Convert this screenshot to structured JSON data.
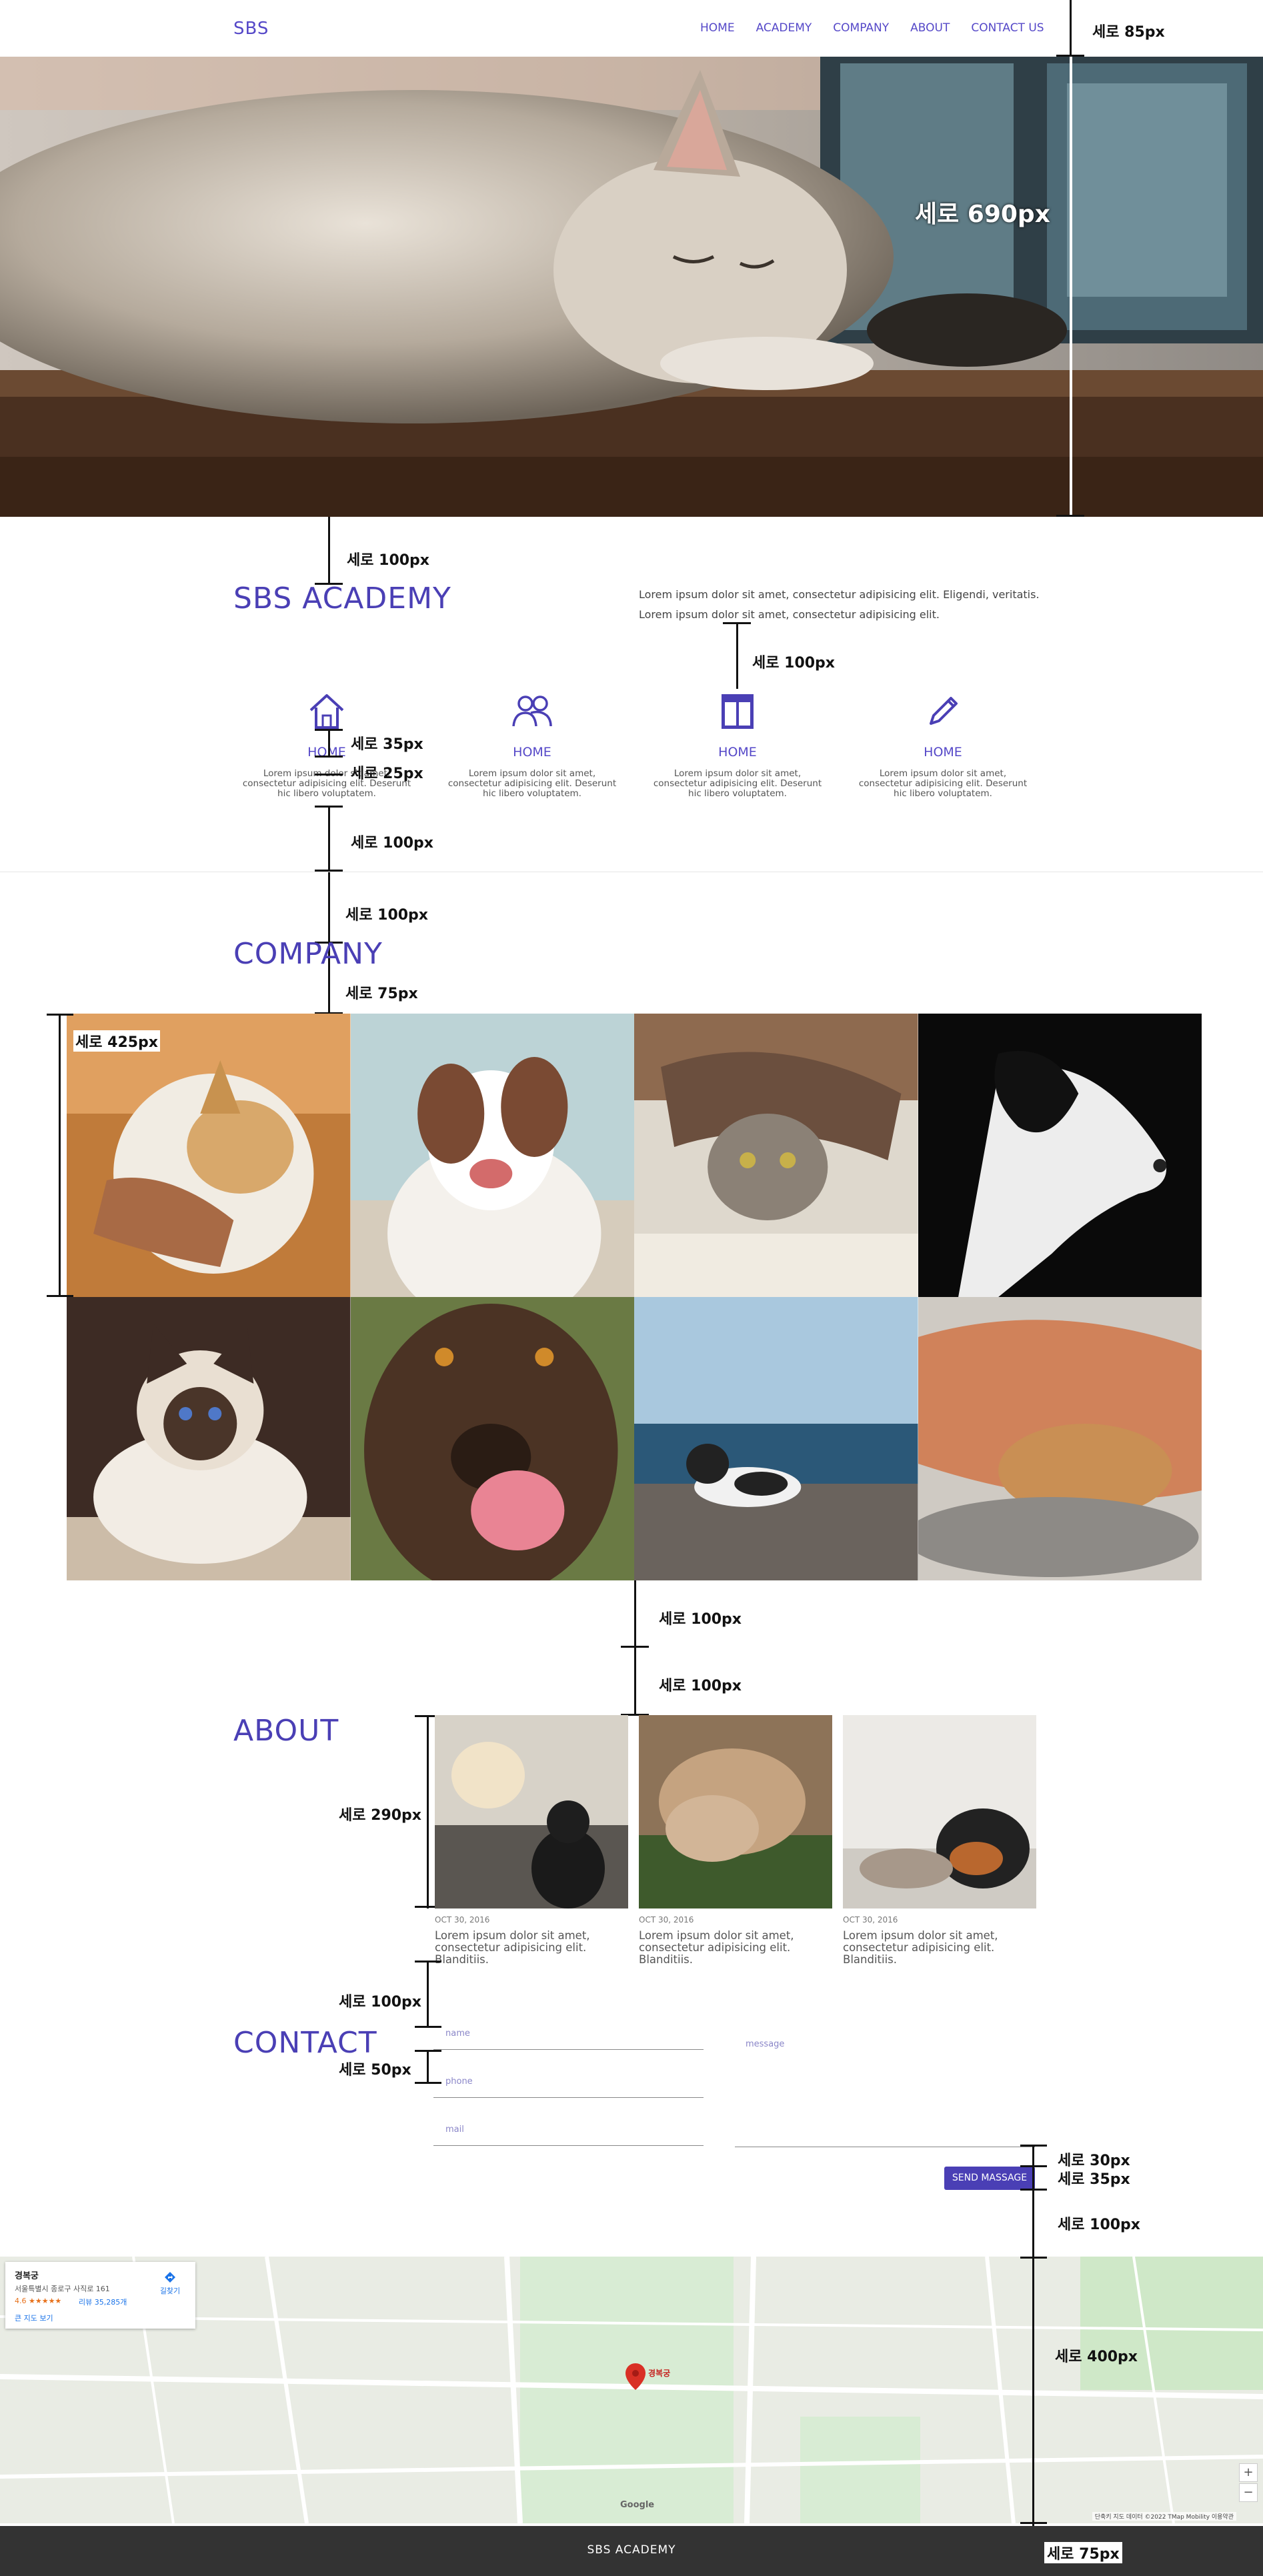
{
  "header": {
    "logo": "SBS",
    "nav": [
      "HOME",
      "ACADEMY",
      "COMPANY",
      "ABOUT",
      "CONTACT US"
    ]
  },
  "annotations": {
    "header_height": "세로 85px",
    "hero_height": "세로 690px",
    "academy_top": "세로 100px",
    "academy_desc_gap": "세로 100px",
    "icon_gap": "세로 35px",
    "title_gap": "세로 25px",
    "features_bottom": "세로 100px",
    "company_top": "세로 100px",
    "company_title_gap": "세로 75px",
    "gallery_row": "세로 425px",
    "gallery_bottom": "세로 100px",
    "about_top": "세로 100px",
    "post_height": "세로 290px",
    "contact_top": "세로 100px",
    "contact_field_gap": "세로 50px",
    "btn_gap": "세로 30px",
    "btn_height": "세로 35px",
    "map_top": "세로 100px",
    "map_height": "세로 400px",
    "footer_height": "세로 75px"
  },
  "academy": {
    "title": "SBS ACADEMY",
    "desc_line1": "Lorem ipsum dolor sit amet, consectetur adipisicing elit. Eligendi, veritatis.",
    "desc_line2": "Lorem ipsum dolor sit amet, consectetur adipisicing elit.",
    "features": [
      {
        "icon": "home-icon",
        "title": "HOME",
        "text": "Lorem ipsum dolor sit amet, consectetur adipisicing elit. Deserunt hic libero voluptatem."
      },
      {
        "icon": "users-icon",
        "title": "HOME",
        "text": "Lorem ipsum dolor sit amet, consectetur adipisicing elit. Deserunt hic libero voluptatem."
      },
      {
        "icon": "layout-icon",
        "title": "HOME",
        "text": "Lorem ipsum dolor sit amet, consectetur adipisicing elit. Deserunt hic libero voluptatem."
      },
      {
        "icon": "pencil-icon",
        "title": "HOME",
        "text": "Lorem ipsum dolor sit amet, consectetur adipisicing elit. Deserunt hic libero voluptatem."
      }
    ]
  },
  "company": {
    "title": "COMPANY"
  },
  "about": {
    "title": "ABOUT",
    "posts": [
      {
        "date": "OCT 30, 2016",
        "text": "Lorem ipsum dolor sit amet, consectetur adipisicing elit. Blanditiis."
      },
      {
        "date": "OCT 30, 2016",
        "text": "Lorem ipsum dolor sit amet, consectetur adipisicing elit. Blanditiis."
      },
      {
        "date": "OCT 30, 2016",
        "text": "Lorem ipsum dolor sit amet, consectetur adipisicing elit. Blanditiis."
      }
    ]
  },
  "contact": {
    "title": "CONTACT",
    "name_placeholder": "name",
    "phone_placeholder": "phone",
    "mail_placeholder": "mail",
    "message_placeholder": "message",
    "send_label": "SEND MASSAGE"
  },
  "map": {
    "place_title": "경복궁",
    "address": "서울특별시 종로구 사직로 161",
    "rating": "4.6 ★★★★★",
    "reviews": "리뷰 35,285개",
    "larger_map": "큰 지도 보기",
    "directions": "길찾기",
    "marker_label": "경복궁",
    "zoom_in": "+",
    "zoom_out": "−",
    "attribution": "단축키   지도 데이터 ©2022 TMap Mobility   이용약관",
    "google": "Google"
  },
  "footer": {
    "text": "SBS ACADEMY"
  },
  "colors": {
    "accent": "#4a3fb5",
    "footer_bg": "#333333"
  }
}
